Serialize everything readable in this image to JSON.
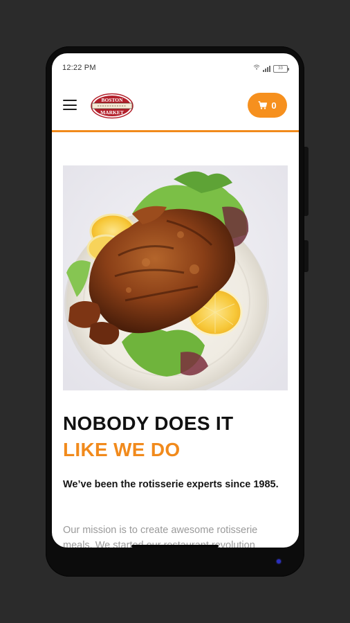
{
  "status_bar": {
    "time": "12:22 PM",
    "battery": "33"
  },
  "header": {
    "menu_icon": "hamburger-menu-icon",
    "logo_text_top": "BOSTON",
    "logo_text_bottom": "MARKET",
    "cart_icon": "shopping-cart-icon",
    "cart_count": "0"
  },
  "hero": {
    "image_subject": "rotisserie-chicken-plate"
  },
  "content": {
    "headline_line1": "NOBODY DOES IT",
    "headline_line2": "LIKE WE DO",
    "tagline": "We’ve been the rotisserie experts since 1985.",
    "mission": "Our mission is to create awesome rotisserie meals. We started our restaurant revolution"
  },
  "colors": {
    "accent": "#f18a1c",
    "cart_button": "#f6901e",
    "logo_red": "#b3202b",
    "headline": "#111111",
    "body_muted": "#9a9a9a"
  }
}
